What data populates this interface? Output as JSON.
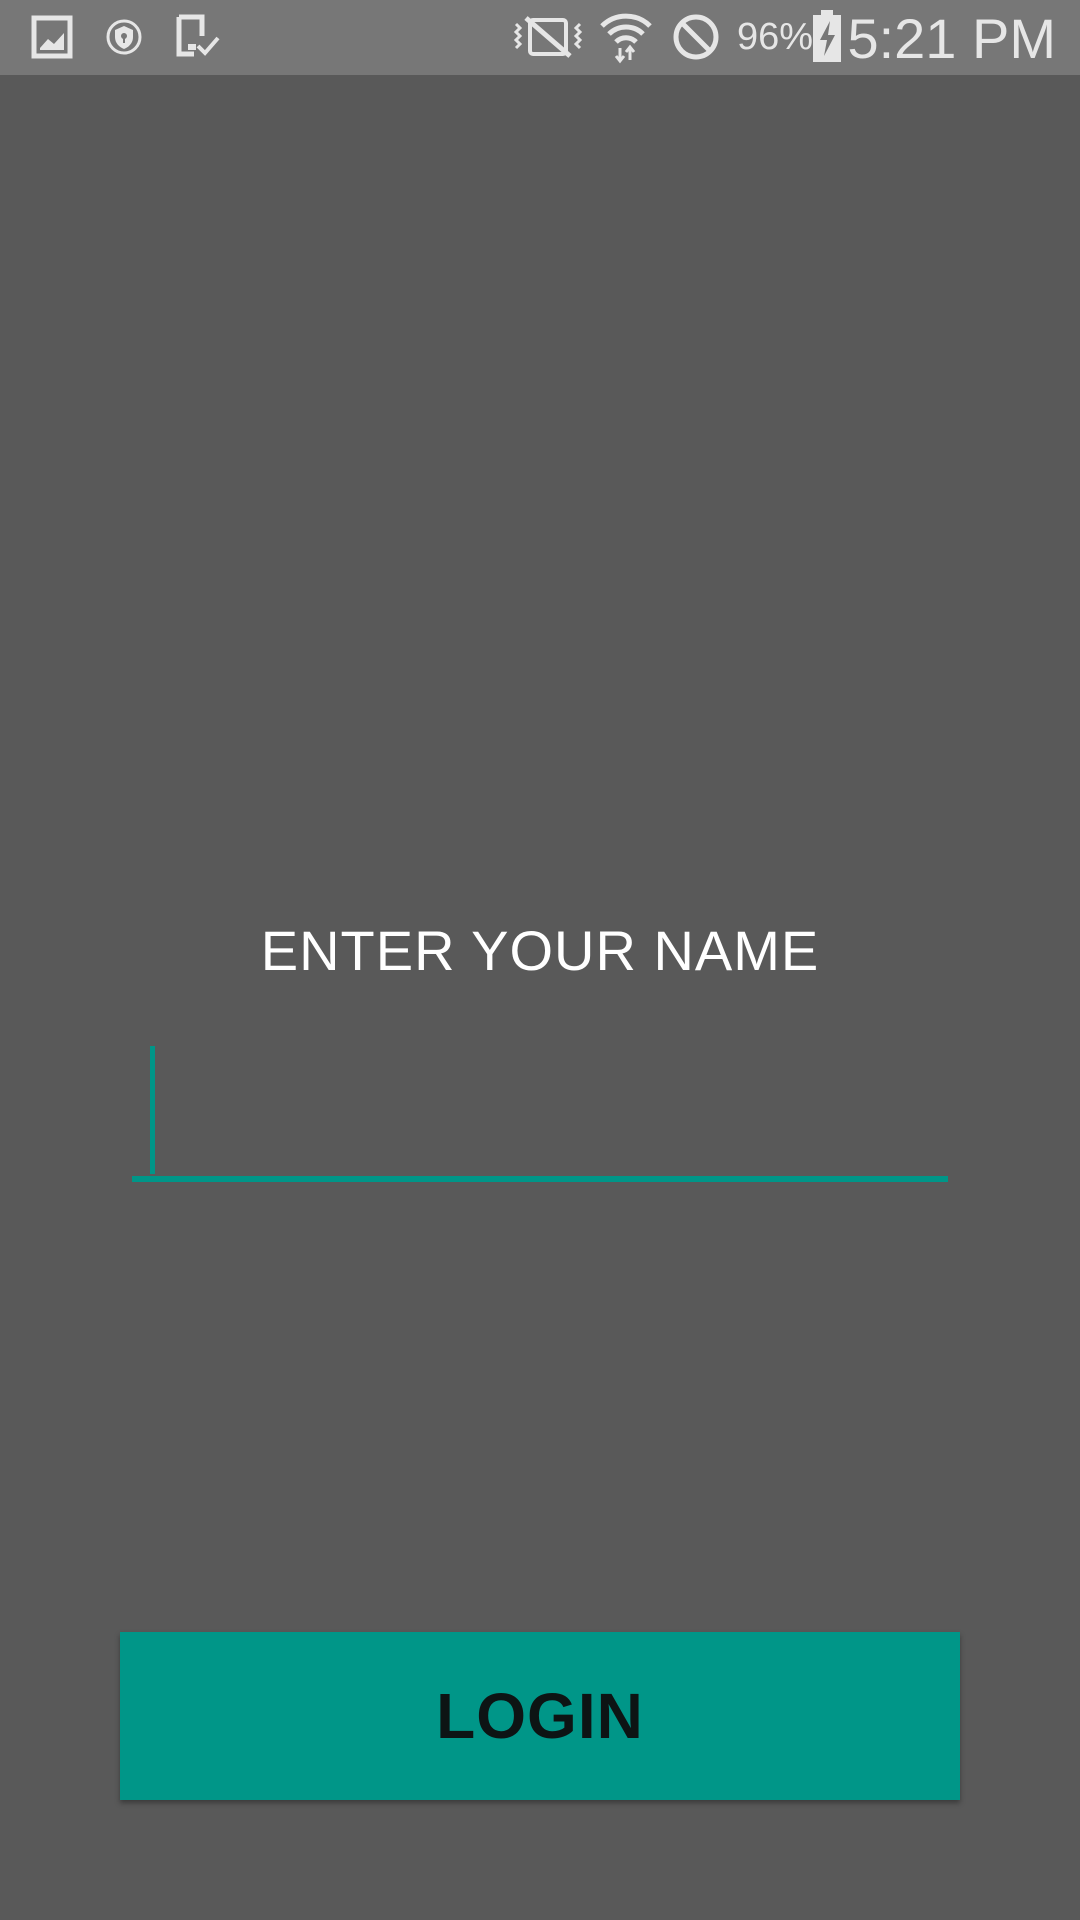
{
  "status_bar": {
    "icons_left": [
      "gallery-icon",
      "security-shield-icon",
      "device-check-icon"
    ],
    "icons_right": [
      "vibrate-mute-icon",
      "wifi-icon",
      "do-not-disturb-icon",
      "battery-charging-icon"
    ],
    "battery_percent": "96%",
    "time": "5:21 PM"
  },
  "main": {
    "prompt": "ENTER YOUR NAME",
    "name_input": {
      "value": "",
      "placeholder": ""
    },
    "login_label": "LOGIN"
  },
  "colors": {
    "background": "#595959",
    "status_bar": "#777777",
    "accent": "#009688",
    "button_text": "#0d1414"
  }
}
